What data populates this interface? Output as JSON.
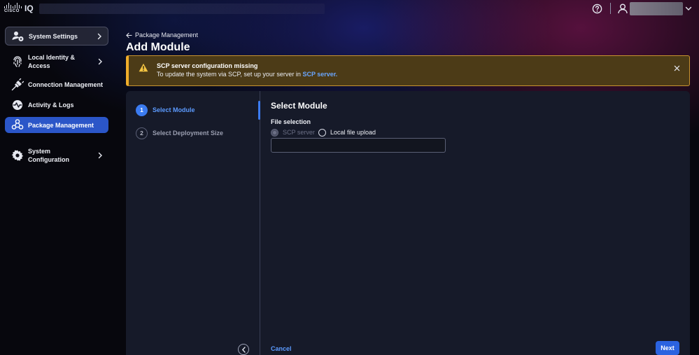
{
  "app": {
    "logo_word": "CISCO",
    "product": "IQ"
  },
  "icons": {
    "help": "help-circle-icon",
    "user": "user-icon",
    "chevron": "chevron-down-icon",
    "warning": "warning-triangle-icon",
    "close": "close-icon"
  },
  "sidebar": {
    "items": [
      {
        "id": "system-settings",
        "label": "System Settings",
        "icon": "users-gear-icon",
        "chevron": true
      },
      {
        "id": "local-identity",
        "label": "Local Identity &",
        "label2": "Access",
        "icon": "fingerprint-icon",
        "chevron": true
      },
      {
        "id": "connection-management",
        "label": "Connection Management",
        "icon": "plug-icon",
        "chevron": false
      },
      {
        "id": "activity-logs",
        "label": "Activity & Logs",
        "icon": "activity-icon",
        "chevron": false
      },
      {
        "id": "package-management",
        "label": "Package Management",
        "icon": "package-icon",
        "chevron": false,
        "active": true
      },
      {
        "id": "system-configuration",
        "label": "System",
        "label2": "Configuration",
        "icon": "gear-icon",
        "chevron": true
      }
    ]
  },
  "header": {
    "back_label": "Package Management",
    "title": "Add Module"
  },
  "banner": {
    "title": "SCP server configuration missing",
    "message": "To update the system via SCP, set up your server in ",
    "link": "SCP server."
  },
  "wizard": {
    "steps": [
      {
        "number": "1",
        "label": "Select Module",
        "active": true
      },
      {
        "number": "2",
        "label": "Select Deployment Size",
        "active": false
      }
    ],
    "section_title": "Select Module",
    "field_label": "File selection",
    "options": [
      {
        "label": "SCP server",
        "disabled": true
      },
      {
        "label": "Local file upload",
        "disabled": false
      }
    ],
    "file_value": "",
    "cancel_label": "Cancel",
    "next_label": "Next"
  },
  "colors": {
    "accent": "#2b63e0",
    "warning_border": "#f0ad2a",
    "warning_bg": "#4c3b17",
    "link": "#5c9bff"
  }
}
